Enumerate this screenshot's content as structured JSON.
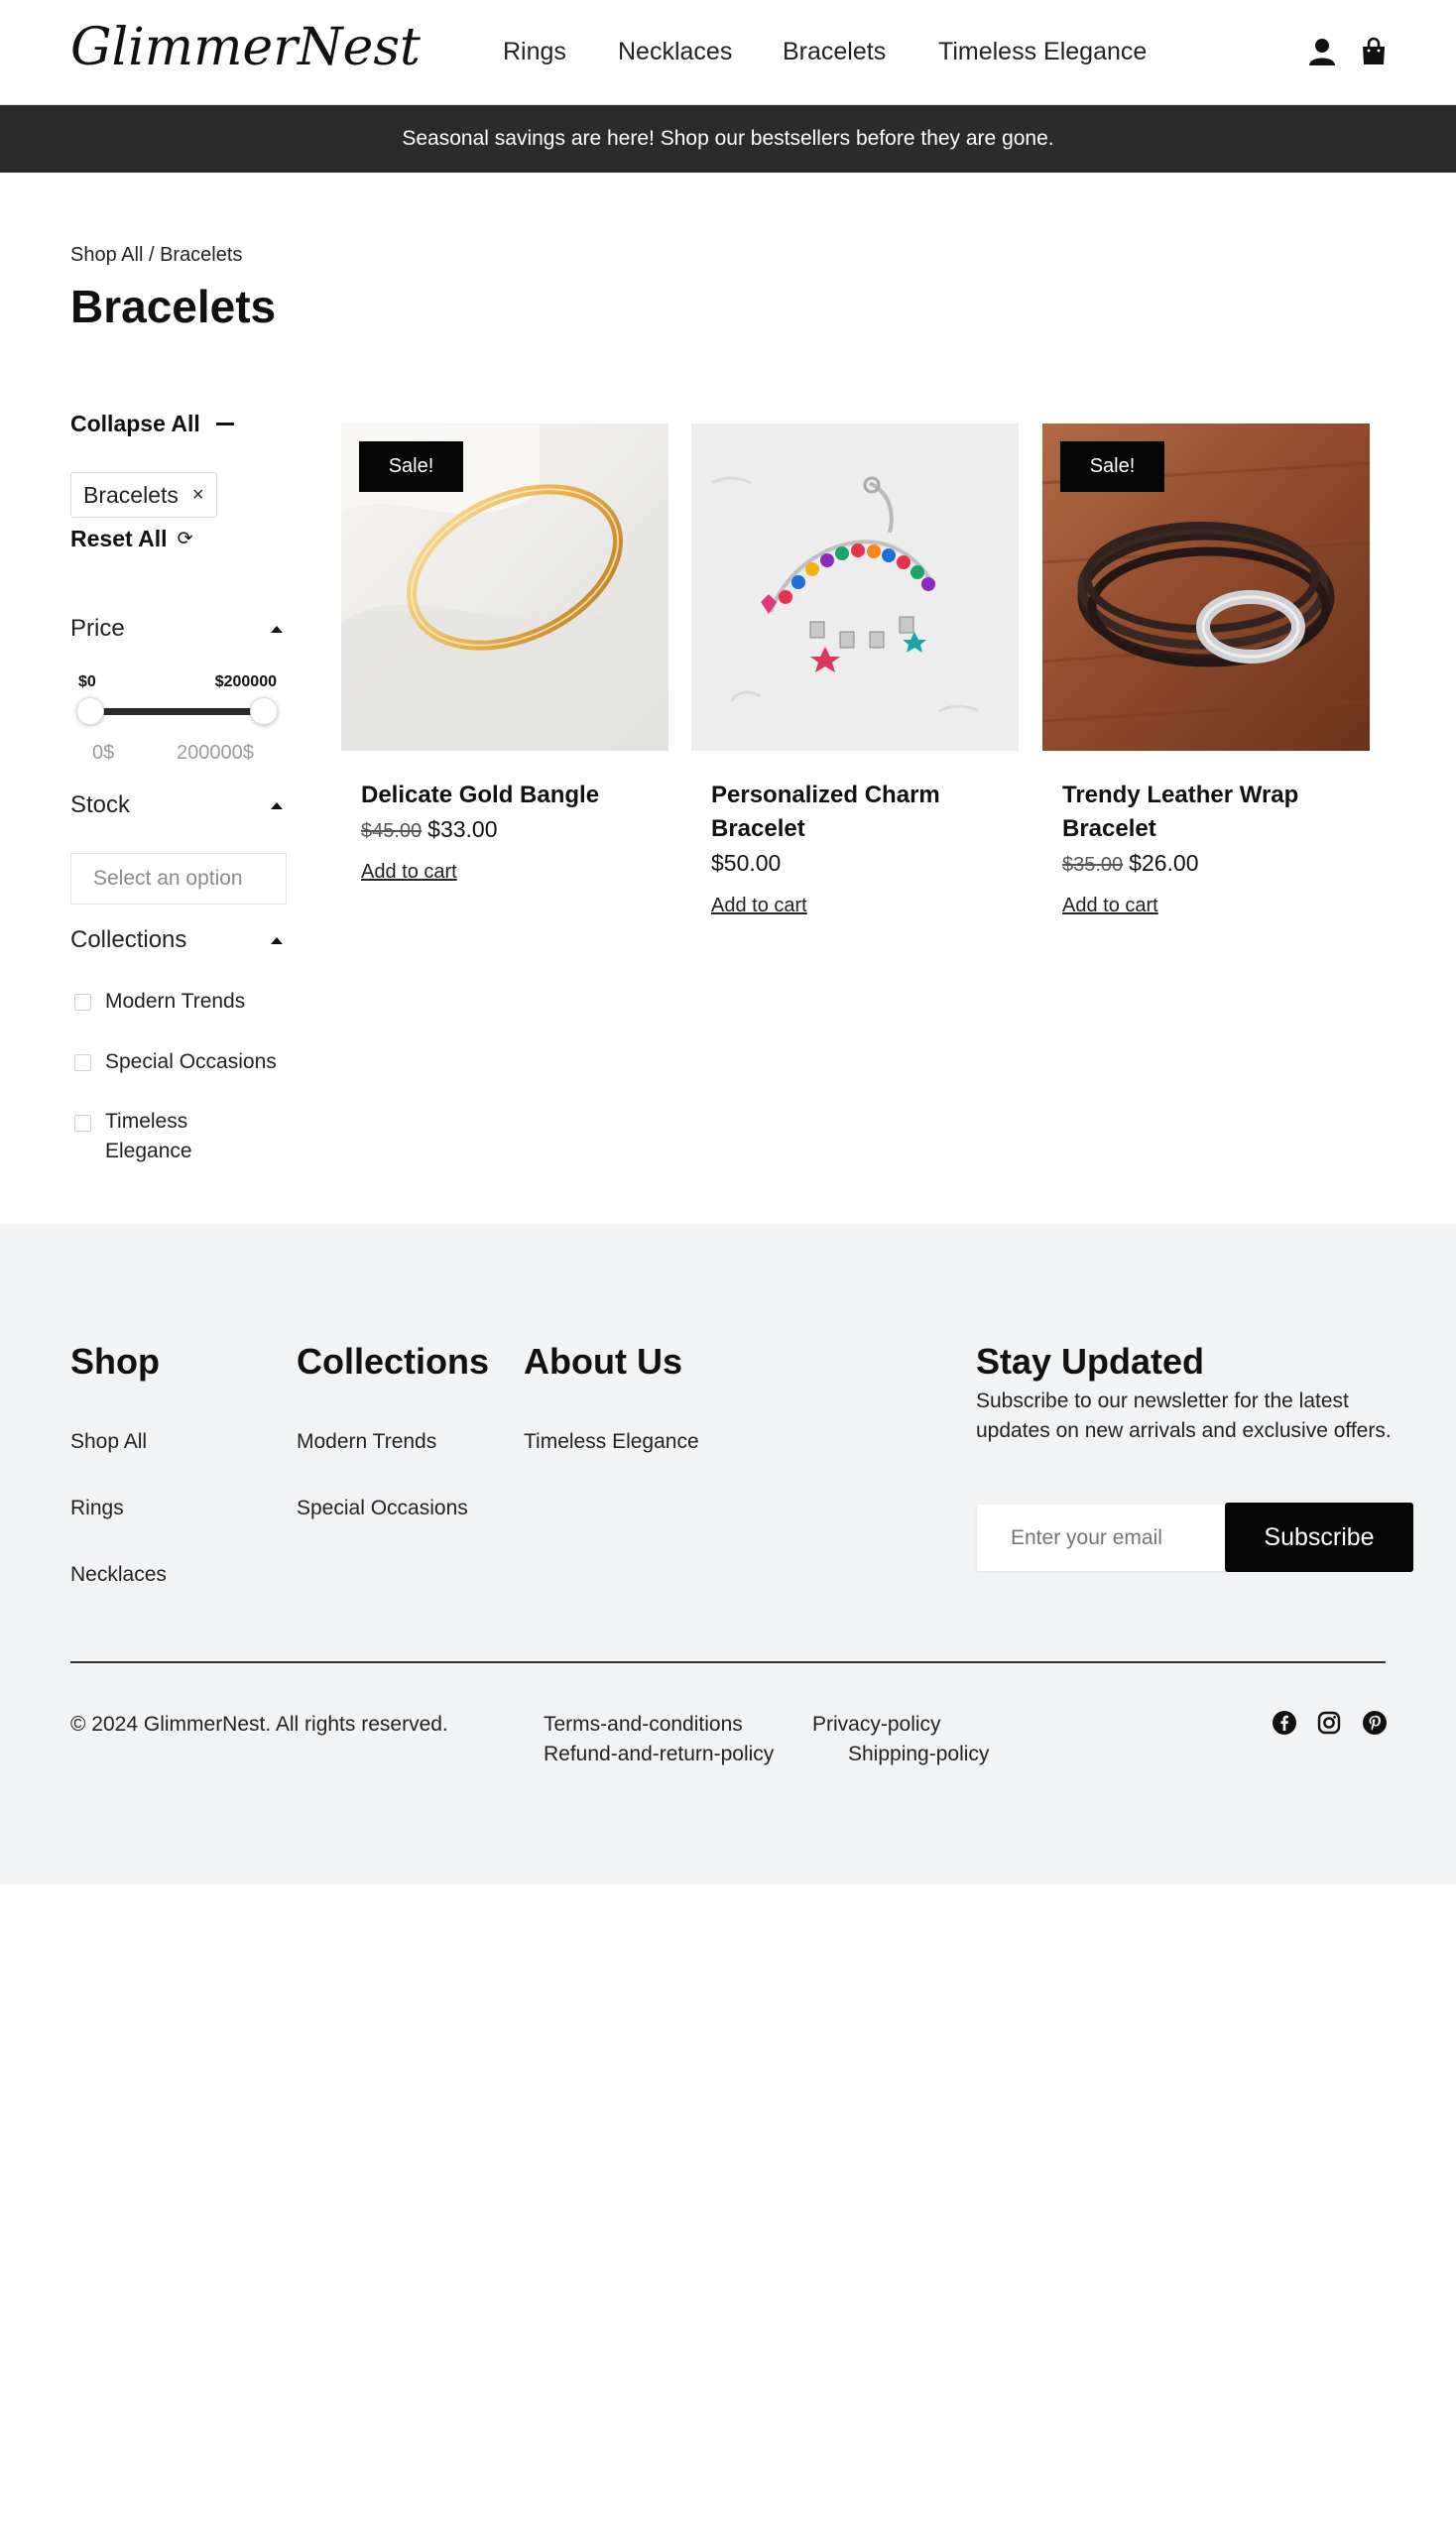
{
  "header": {
    "logo": "GlimmerNest",
    "nav": [
      "Rings",
      "Necklaces",
      "Bracelets",
      "Timeless Elegance"
    ],
    "icons": [
      "user-icon",
      "shopping-bag-icon"
    ]
  },
  "announcement": "Seasonal savings are here! Shop our bestsellers before they are gone.",
  "breadcrumb": {
    "parent": "Shop All",
    "separator": " / ",
    "current": "Bracelets"
  },
  "page_title": "Bracelets",
  "sidebar": {
    "collapse_all": "Collapse All",
    "active_filter_chip": "Bracelets",
    "chip_close": "×",
    "reset_all": "Reset All",
    "reset_icon": "⟳",
    "price": {
      "label": "Price",
      "min_label": "$0",
      "max_label": "$200000",
      "min_value": "0$",
      "max_value": "200000$"
    },
    "stock": {
      "label": "Stock",
      "placeholder": "Select an option"
    },
    "collections": {
      "label": "Collections",
      "items": [
        "Modern Trends",
        "Special Occasions",
        "Timeless Elegance"
      ]
    }
  },
  "products": [
    {
      "name": "Delicate Gold Bangle",
      "sale_badge": "Sale!",
      "old_price": "$45.00",
      "price": "$33.00",
      "cta": "Add to cart"
    },
    {
      "name": "Personalized Charm Bracelet",
      "sale_badge": "",
      "old_price": "",
      "price": "$50.00",
      "cta": "Add to cart"
    },
    {
      "name": "Trendy Leather Wrap Bracelet",
      "sale_badge": "Sale!",
      "old_price": "$35.00",
      "price": "$26.00",
      "cta": "Add to cart"
    }
  ],
  "footer": {
    "shop": {
      "title": "Shop",
      "links": [
        "Shop All",
        "Rings",
        "Necklaces"
      ]
    },
    "collections": {
      "title": "Collections",
      "links": [
        "Modern Trends",
        "Special Occasions"
      ]
    },
    "about": {
      "title": "About Us",
      "links": [
        "Timeless Elegance"
      ]
    },
    "newsletter": {
      "title": "Stay Updated",
      "text": "Subscribe to our newsletter for the latest updates on new arrivals and exclusive offers.",
      "placeholder": "Enter your email",
      "button": "Subscribe"
    },
    "copyright": "© 2024 GlimmerNest. All rights reserved.",
    "legal": [
      "Terms-and-conditions",
      "Privacy-policy",
      "Refund-and-return-policy",
      "Shipping-policy"
    ],
    "social": [
      "facebook-icon",
      "instagram-icon",
      "pinterest-icon"
    ]
  },
  "colors": {
    "announcement_bg": "#2b2b2b",
    "footer_bg": "#f2f3f5",
    "button_bg": "#050505"
  }
}
